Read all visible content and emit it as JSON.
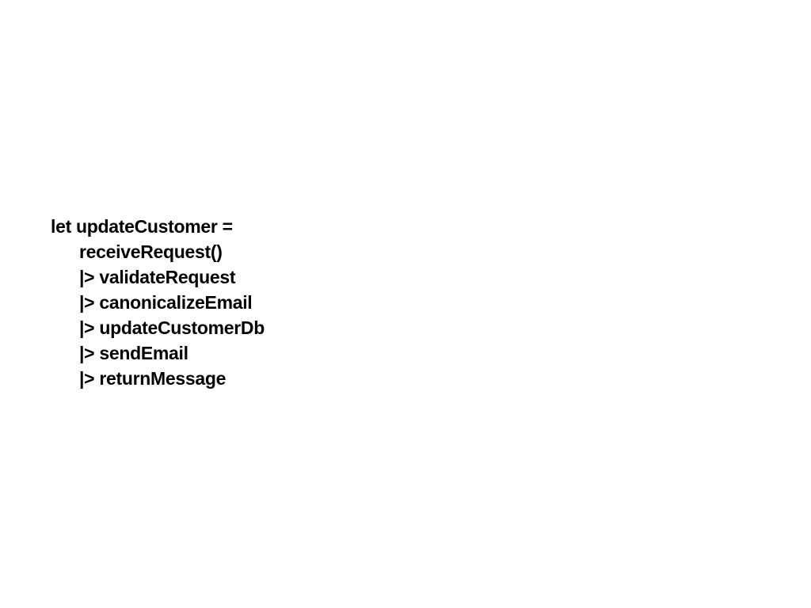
{
  "slide": {
    "code_lines": [
      "let updateCustomer =",
      "receiveRequest()",
      "|> validateRequest",
      "|> canonicalizeEmail",
      "|> updateCustomerDb",
      "|> sendEmail",
      "|> returnMessage"
    ]
  }
}
